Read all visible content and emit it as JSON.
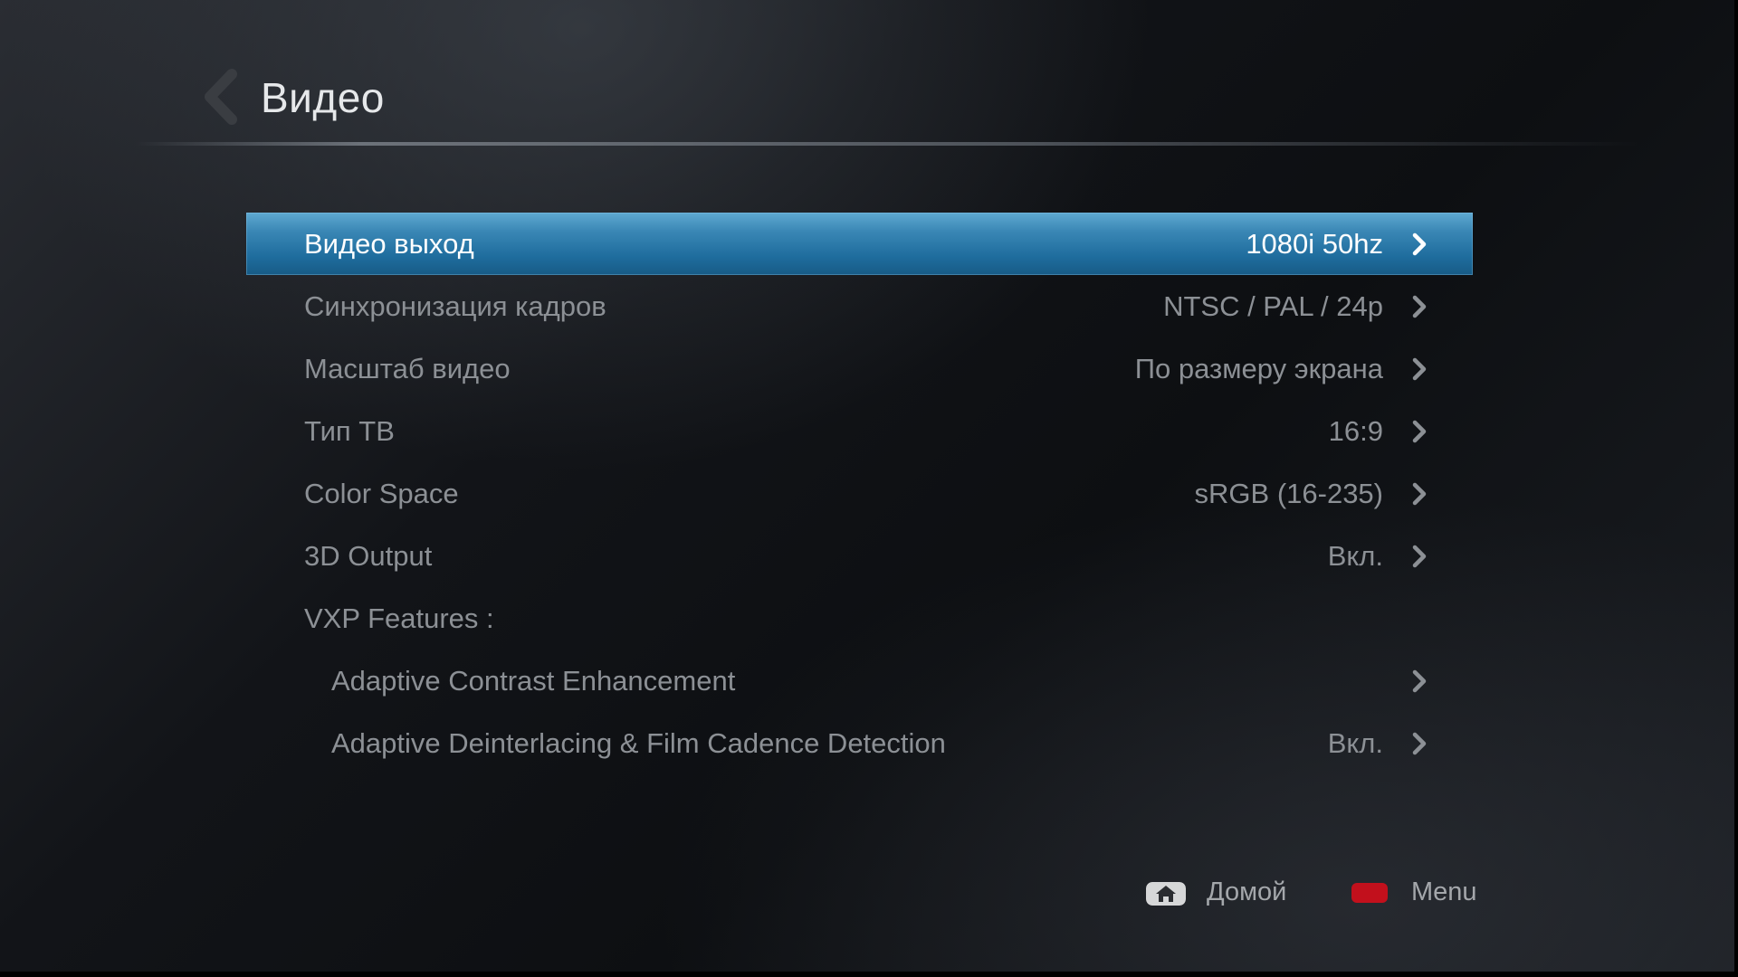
{
  "header": {
    "title": "Видео",
    "back_icon": "chevron-left-icon"
  },
  "menu": {
    "items": [
      {
        "label": "Видео выход",
        "value": "1080i 50hz",
        "selected": true
      },
      {
        "label": "Синхронизация кадров",
        "value": "NTSC / PAL / 24p"
      },
      {
        "label": "Масштаб видео",
        "value": "По размеру экрана"
      },
      {
        "label": "Тип ТВ",
        "value": "16:9"
      },
      {
        "label": "Color Space",
        "value": "sRGB (16-235)"
      },
      {
        "label": "3D Output",
        "value": "Вкл."
      },
      {
        "label": "VXP Features :"
      },
      {
        "label": "Adaptive Contrast Enhancement",
        "value": ""
      },
      {
        "label": "Adaptive Deinterlacing & Film Cadence Detection",
        "value": "Вкл."
      }
    ]
  },
  "footer": {
    "home_label": "Домой",
    "home_icon": "home-key-icon",
    "menu_label": "Menu",
    "menu_icon": "red-key-icon"
  },
  "colors": {
    "selection": "#2a7fb0",
    "text_normal": "#8c9095",
    "text_selected": "#ffffff",
    "red_key": "#c2101c"
  }
}
